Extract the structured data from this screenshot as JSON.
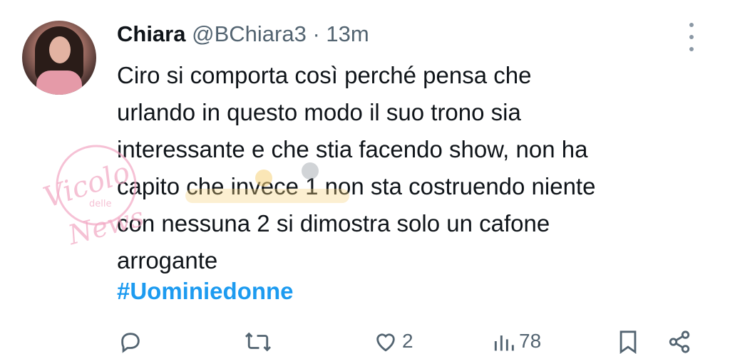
{
  "tweet": {
    "author_name": "Chiara",
    "handle": "@BChiara3",
    "separator": "·",
    "time": "13m",
    "lines": [
      "Ciro si comporta così perché pensa che",
      "urlando in questo modo il suo trono sia",
      "interessante e che stia facendo show, non ha",
      "capito che invece 1 non sta costruendo niente",
      "con nessuna 2 si dimostra solo un cafone",
      "arrogante"
    ],
    "hashtag": "#Uominiedonne"
  },
  "actions": {
    "reply_icon": "reply-icon",
    "retweet_icon": "retweet-icon",
    "like_icon": "heart-icon",
    "like_count": "2",
    "views_icon": "views-icon",
    "views_count": "78",
    "bookmark_icon": "bookmark-icon",
    "share_icon": "share-icon"
  },
  "watermark": {
    "brand": "Vicolo",
    "middle": "delle",
    "tail": "News"
  },
  "colors": {
    "accent": "#1d9bf0",
    "muted": "#536471",
    "text": "#0f1419",
    "watermark": "#f2a7c3"
  }
}
